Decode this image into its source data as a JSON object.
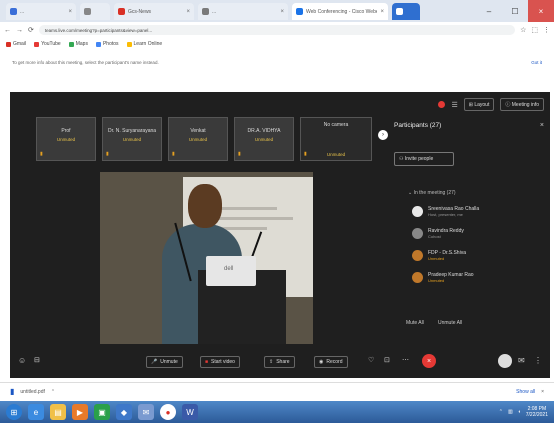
{
  "browser": {
    "tabs": [
      {
        "label": "...",
        "color": "#3b6fd8"
      },
      {
        "label": "",
        "color": "#888888"
      },
      {
        "label": "Gcs-News",
        "color": "#d93025"
      },
      {
        "label": "...",
        "color": "#7a7a7a"
      },
      {
        "label": "Web Conferencing - Cisco Webex",
        "color": "#1a73e8"
      },
      {
        "label": "",
        "color": "#1a73e8"
      }
    ],
    "url": "teams.live.com/meeting?p=participants&view=panel...",
    "bookmarks": [
      {
        "label": "Gmail",
        "color": "#d93025"
      },
      {
        "label": "YouTube",
        "color": "#e53935"
      },
      {
        "label": "Maps",
        "color": "#34a853"
      },
      {
        "label": "Photos",
        "color": "#4285f4"
      },
      {
        "label": "Learn Online",
        "color": "#fbbc04"
      }
    ],
    "info_text": "To get more info about this meeting, select the participant's name instead.",
    "info_link": "Got it"
  },
  "meeting": {
    "top_controls": {
      "layout_label": "Layout",
      "meeting_info_label": "Meeting info"
    },
    "tiles": [
      {
        "name": "Prof",
        "status": "Unmuted"
      },
      {
        "name": "Dr. N. Suryanarayana",
        "status": "Unmuted"
      },
      {
        "name": "Venkat",
        "status": "Unmuted"
      },
      {
        "name": "DR.A. VIDHYA",
        "status": "Unmuted"
      },
      {
        "name": "No camera",
        "status": "Unmuted"
      }
    ],
    "participants": {
      "title": "Participants (27)",
      "invite_label": "Invite people",
      "in_meeting_label": "In the meeting (27)",
      "list": [
        {
          "name": "Sreenivasa Rao Challa",
          "role": "Host, presenter, me",
          "color": "#e8e8e8",
          "warn": false
        },
        {
          "name": "Ravindra Reddy",
          "role": "Cohost",
          "color": "#888888",
          "warn": false
        },
        {
          "name": "FDP - Dr.S.Shiva",
          "role": "Unmuted",
          "color": "#c0782a",
          "warn": true
        },
        {
          "name": "Pradeep Kumar Rao",
          "role": "Unmuted",
          "color": "#c0782a",
          "warn": true
        }
      ],
      "mute_all": "Mute All",
      "unmute_all": "Unmute All"
    },
    "bottom_bar": {
      "unmute_label": "Unmute",
      "video_label": "Start video",
      "share_label": "Share",
      "record_label": "Record",
      "leave_icon": "close-icon"
    },
    "presenter_logo": "dell"
  },
  "downloads": {
    "file": "untitled.pdf",
    "show_all": "Show all"
  },
  "taskbar": {
    "apps": [
      "start",
      "ie",
      "explorer",
      "media",
      "store",
      "chrome",
      "outlook",
      "word"
    ],
    "time": "2:08 PM",
    "date": "7/22/2021"
  }
}
